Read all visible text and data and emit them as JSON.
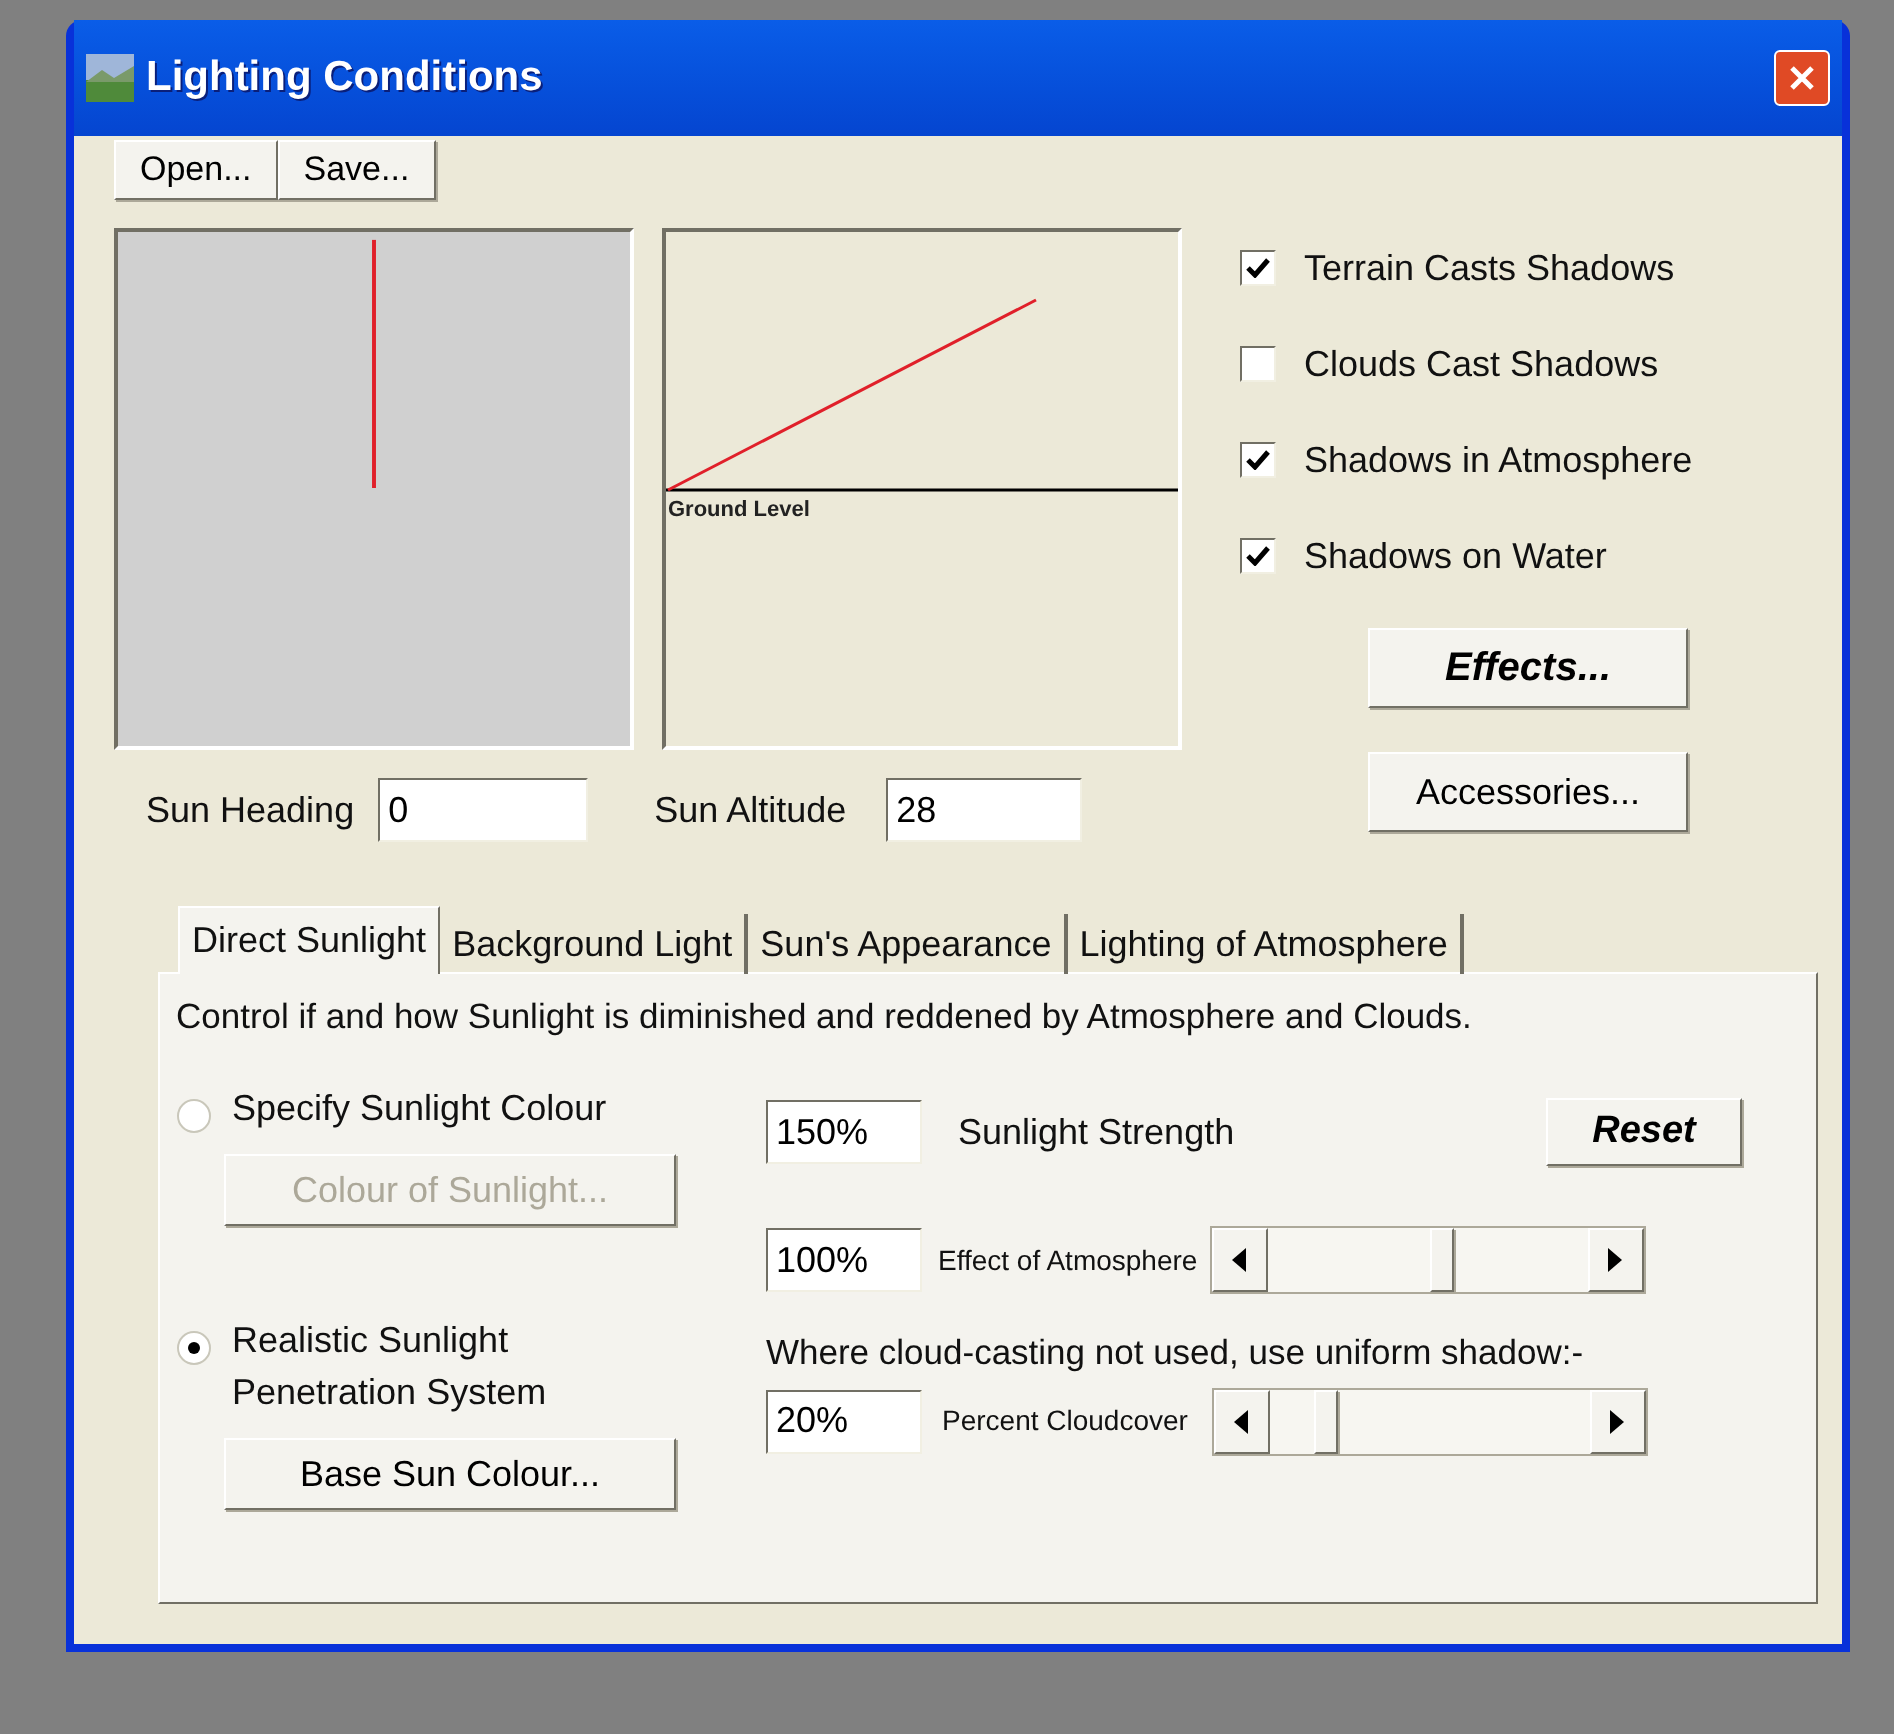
{
  "window": {
    "title": "Lighting Conditions"
  },
  "toolbar": [
    "Open...",
    "Save..."
  ],
  "sun_heading": {
    "label": "Sun Heading",
    "value": "0"
  },
  "sun_altitude": {
    "label": "Sun Altitude",
    "value": "28",
    "graph_label": "Ground Level"
  },
  "shadow_options": [
    {
      "label": "Terrain Casts Shadows",
      "checked": true
    },
    {
      "label": "Clouds Cast Shadows",
      "checked": false
    },
    {
      "label": "Shadows in Atmosphere",
      "checked": true
    },
    {
      "label": "Shadows on Water",
      "checked": true
    }
  ],
  "buttons": [
    {
      "label": "Effects...",
      "kind": "bold"
    },
    {
      "label": "Accessories...",
      "kind": "plain"
    }
  ],
  "tabs": [
    {
      "label": "Direct Sunlight",
      "selected": true
    },
    {
      "label": "Background Light",
      "selected": false
    },
    {
      "label": "Sun's Appearance",
      "selected": false
    },
    {
      "label": "Lighting of Atmosphere",
      "selected": false
    }
  ],
  "panel": {
    "description": "Control if and how Sunlight is diminished and reddened by Atmosphere and Clouds.",
    "radios": [
      {
        "label": "Specify Sunlight Colour",
        "selected": false,
        "button": {
          "label": "Colour of Sunlight...",
          "disabled": true
        }
      },
      {
        "label": "Realistic Sunlight Penetration System",
        "selected": true,
        "button": {
          "label": "Base Sun Colour...",
          "disabled": false
        }
      }
    ],
    "sunlight_strength": {
      "value": "150%",
      "label": "Sunlight Strength"
    },
    "reset": "Reset",
    "effect_of_atmosphere": {
      "value": "100%",
      "label": "Effect of Atmosphere",
      "level": 0.55
    },
    "uniform_shadow_note": "Where cloud-casting not used, use uniform shadow:-",
    "percent_cloudcover": {
      "value": "20%",
      "label": "Percent Cloudcover",
      "level": 0.15
    }
  }
}
